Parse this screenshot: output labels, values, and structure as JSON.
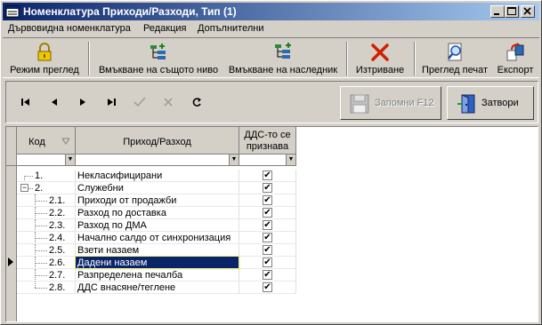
{
  "window": {
    "title": "Номенклатура Приходи/Разходи, Тип (1)"
  },
  "menu": {
    "items": [
      {
        "label": "Дървовидна номенклатура"
      },
      {
        "label": "Редакция"
      },
      {
        "label": "Допълнителни"
      }
    ]
  },
  "toolbar": {
    "view_mode": "Режим преглед",
    "insert_same_level": "Вмъкване на същото ниво",
    "insert_child": "Вмъкване на наследник",
    "delete": "Изтриване",
    "print_preview": "Преглед печат",
    "export": "Експорт"
  },
  "nav": {
    "save_label": "Запомни  F12",
    "close_label": "Затвори"
  },
  "grid": {
    "columns": {
      "code": "Код",
      "name": "Приход/Разход",
      "vat_line1": "ДДС-то се",
      "vat_line2": "признава"
    },
    "rows": [
      {
        "code": "1.",
        "name": "Некласифицирани",
        "vat": "✔"
      },
      {
        "code": "2.",
        "name": "Служебни",
        "vat": "✔"
      },
      {
        "code": "2.1.",
        "name": "Приходи от продажби",
        "vat": "✔"
      },
      {
        "code": "2.2.",
        "name": "Разход по доставка",
        "vat": "✔"
      },
      {
        "code": "2.3.",
        "name": "Разход по ДМА",
        "vat": "✔"
      },
      {
        "code": "2.4.",
        "name": "Начално салдо от синхронизация",
        "vat": "✔"
      },
      {
        "code": "2.5.",
        "name": "Взети назаем",
        "vat": "✔"
      },
      {
        "code": "2.6.",
        "name": "Дадени назаем",
        "vat": "✔"
      },
      {
        "code": "2.7.",
        "name": "Разпределена печалба",
        "vat": "✔"
      },
      {
        "code": "2.8.",
        "name": "ДДС внасяне/теглене",
        "vat": "✔"
      }
    ]
  },
  "colors": {
    "titlebar_start": "#0a246a",
    "titlebar_end": "#a6caf0",
    "selection": "#0a246a",
    "face": "#d4d0c8"
  }
}
